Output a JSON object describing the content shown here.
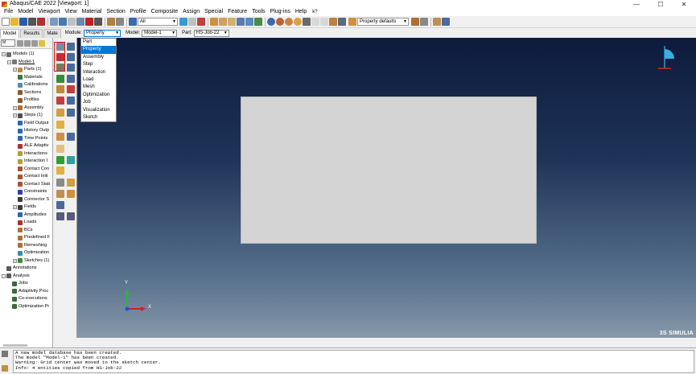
{
  "window": {
    "title": "Abaqus/CAE 2022 [Viewport: 1]",
    "controls": [
      "—",
      "☐",
      "✕"
    ]
  },
  "menu": [
    "File",
    "Model",
    "Viewport",
    "View",
    "Material",
    "Section",
    "Profile",
    "Composite",
    "Assign",
    "Special",
    "Feature",
    "Tools",
    "Plug-ins",
    "Help",
    "k?"
  ],
  "toolbar": {
    "selection_combo": "All",
    "display_combo": "Property defaults"
  },
  "tabs": [
    "Model",
    "Results",
    "Mate"
  ],
  "context": {
    "module_label": "Module:",
    "module_value": "Property",
    "model_label": "Model:",
    "model_value": "Model-1",
    "part_label": "Part:",
    "part_value": "HS-Job-22"
  },
  "module_options": [
    "Part",
    "Property",
    "Assembly",
    "Step",
    "Interaction",
    "Load",
    "Mesh",
    "Optimization",
    "Job",
    "Visualization",
    "Sketch"
  ],
  "selected_module": "Property",
  "tree_combo": "M",
  "tree": [
    {
      "label": "Models (1)",
      "indent": 0,
      "exp": "−",
      "color": "#6a6a6a"
    },
    {
      "label": "Model-1",
      "indent": 1,
      "exp": "−",
      "color": "#777777",
      "underline": true
    },
    {
      "label": "Parts (1)",
      "indent": 2,
      "exp": "+",
      "color": "#c08a3a"
    },
    {
      "label": "Materials",
      "indent": 2,
      "exp": "",
      "color": "#3a7a3a"
    },
    {
      "label": "Calibrations",
      "indent": 2,
      "exp": "",
      "color": "#5a8ab0"
    },
    {
      "label": "Sections",
      "indent": 2,
      "exp": "",
      "color": "#8a5a2a"
    },
    {
      "label": "Profiles",
      "indent": 2,
      "exp": "",
      "color": "#8a5a2a"
    },
    {
      "label": "Assembly",
      "indent": 2,
      "exp": "+",
      "color": "#b07030"
    },
    {
      "label": "Steps (1)",
      "indent": 2,
      "exp": "+",
      "color": "#505050"
    },
    {
      "label": "Field Output",
      "indent": 2,
      "exp": "",
      "color": "#2a6ab0"
    },
    {
      "label": "History Outp",
      "indent": 2,
      "exp": "",
      "color": "#2a6ab0"
    },
    {
      "label": "Time Points",
      "indent": 2,
      "exp": "",
      "color": "#2a6ab0"
    },
    {
      "label": "ALE Adaptiv",
      "indent": 2,
      "exp": "",
      "color": "#b03030"
    },
    {
      "label": "Interactions",
      "indent": 2,
      "exp": "",
      "color": "#b0a030"
    },
    {
      "label": "Interaction I",
      "indent": 2,
      "exp": "",
      "color": "#b0a030"
    },
    {
      "label": "Contact Con",
      "indent": 2,
      "exp": "",
      "color": "#b05030"
    },
    {
      "label": "Contact Initi",
      "indent": 2,
      "exp": "",
      "color": "#b05030"
    },
    {
      "label": "Contact Stab",
      "indent": 2,
      "exp": "",
      "color": "#b05030"
    },
    {
      "label": "Constraints",
      "indent": 2,
      "exp": "",
      "color": "#3a3ab0"
    },
    {
      "label": "Connector S",
      "indent": 2,
      "exp": "",
      "color": "#3a3a3a"
    },
    {
      "label": "Fields",
      "indent": 2,
      "exp": "+",
      "color": "#3a3a3a"
    },
    {
      "label": "Amplitudes",
      "indent": 2,
      "exp": "",
      "color": "#2a6ab0"
    },
    {
      "label": "Loads",
      "indent": 2,
      "exp": "",
      "color": "#b03030"
    },
    {
      "label": "BCs",
      "indent": 2,
      "exp": "",
      "color": "#b07030"
    },
    {
      "label": "Predefined F",
      "indent": 2,
      "exp": "",
      "color": "#b07030"
    },
    {
      "label": "Remeshing",
      "indent": 2,
      "exp": "",
      "color": "#b07030"
    },
    {
      "label": "Optimization",
      "indent": 2,
      "exp": "",
      "color": "#3a8ab0"
    },
    {
      "label": "Sketches (1)",
      "indent": 2,
      "exp": "+",
      "color": "#3a8a3a"
    },
    {
      "label": "Annotations",
      "indent": 0,
      "exp": "",
      "color": "#5a5a5a"
    },
    {
      "label": "Analysis",
      "indent": 0,
      "exp": "−",
      "color": "#5a5a5a"
    },
    {
      "label": "Jobs",
      "indent": 1,
      "exp": "",
      "color": "#3a6a3a"
    },
    {
      "label": "Adaptivity Proc",
      "indent": 1,
      "exp": "",
      "color": "#3a6a3a"
    },
    {
      "label": "Co-executions",
      "indent": 1,
      "exp": "",
      "color": "#3a6a3a"
    },
    {
      "label": "Optimization Pr",
      "indent": 1,
      "exp": "",
      "color": "#3a6a3a"
    }
  ],
  "viewport": {
    "logo": "3S SIMULIA",
    "triad_y": "Y",
    "triad_x": "X"
  },
  "messages": [
    "A new model database has been created.",
    "The model \"Model-1\" has been created.",
    "Warning: Grid center was moved to the sketch center.",
    "Info: 4 entities copied from HS-Job-22"
  ],
  "colors": {
    "selection_blue": "#0078d7",
    "highlight_red": "#e01010",
    "viewport_top": "#0d1b3c",
    "viewport_bottom": "#8798aa"
  }
}
